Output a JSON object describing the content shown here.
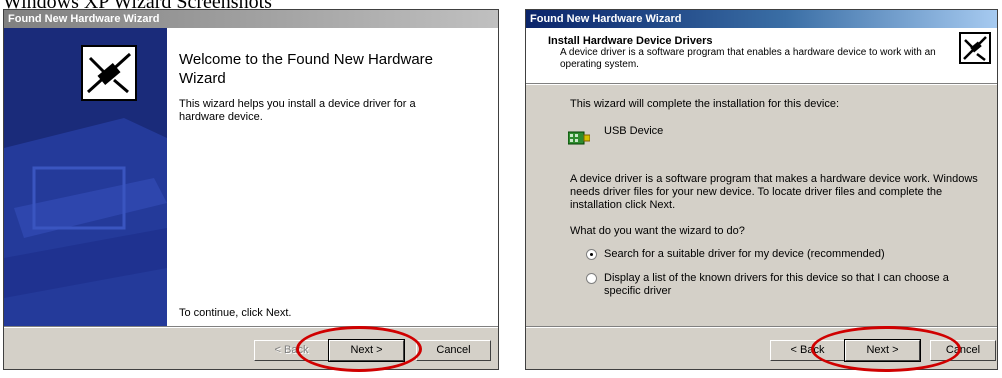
{
  "page_text": "Windows XP Wizard Screenshots",
  "left_window": {
    "title": "Found New Hardware Wizard",
    "welcome_title": "Welcome to the Found New Hardware Wizard",
    "description": "This wizard helps you install a device driver for a hardware device.",
    "continue_text": "To continue, click Next.",
    "buttons": {
      "back": "< Back",
      "next": "Next >",
      "cancel": "Cancel"
    }
  },
  "right_window": {
    "title": "Found New Hardware Wizard",
    "header_title": "Install Hardware Device Drivers",
    "header_subtitle": "A device driver is a software program that enables a hardware device to work with an operating system.",
    "intro": "This wizard will complete the installation for this device:",
    "device_name": "USB Device",
    "driver_info": "A device driver is a software program that makes a hardware device work. Windows needs driver files for your new device. To locate driver files and complete the installation click Next.",
    "question": "What do you want the wizard to do?",
    "options": [
      {
        "label": "Search for a suitable driver for my device (recommended)",
        "selected": true
      },
      {
        "label": "Display a list of the known drivers for this device so that I can choose a specific driver",
        "selected": false
      }
    ],
    "buttons": {
      "back": "< Back",
      "next": "Next >",
      "cancel": "Cancel"
    }
  },
  "icons": {
    "wizard_art": "hardware-wizard-icon",
    "header_icon": "hardware-wizard-icon",
    "device_icon": "usb-device-icon"
  },
  "colors": {
    "highlight_ellipse": "#d00000",
    "active_titlebar": "#0a246a",
    "inactive_titlebar": "#808080",
    "dialog_face": "#d4d0c8"
  }
}
